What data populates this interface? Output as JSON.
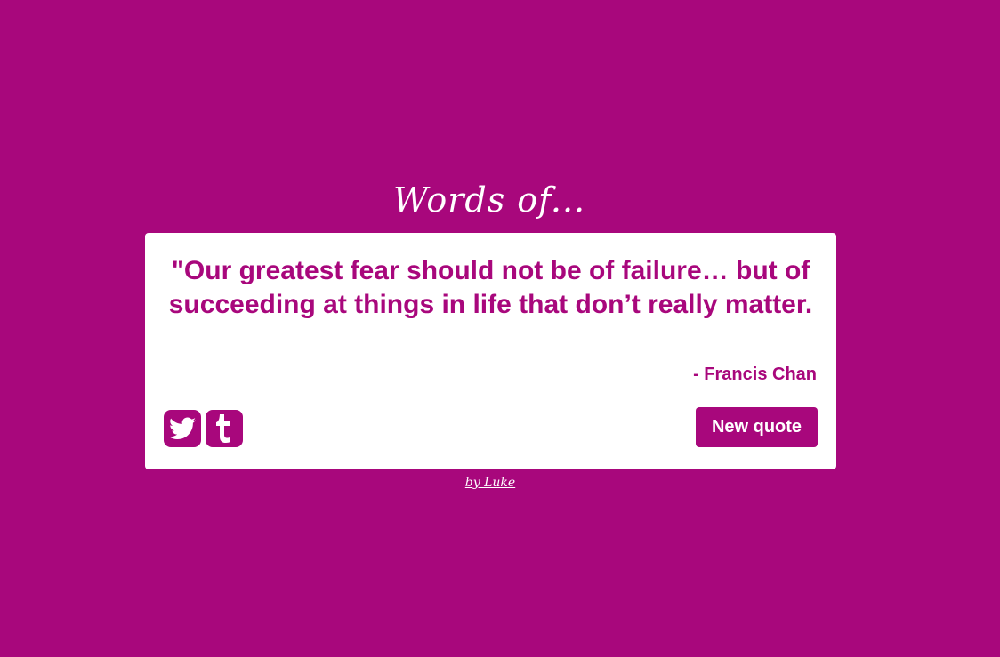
{
  "header": {
    "title": "Words of..."
  },
  "quote_card": {
    "quote_text": "\"Our greatest fear should not be of failure… but of succeeding at things in life that don’t really matter.",
    "author": "- Francis Chan",
    "share": [
      {
        "icon": "twitter-icon"
      },
      {
        "icon": "tumblr-icon"
      }
    ],
    "new_quote_label": "New quote"
  },
  "footer": {
    "credit": "by Luke"
  },
  "colors": {
    "background": "#a8077c",
    "card": "#ffffff",
    "accent": "#a8077c"
  }
}
